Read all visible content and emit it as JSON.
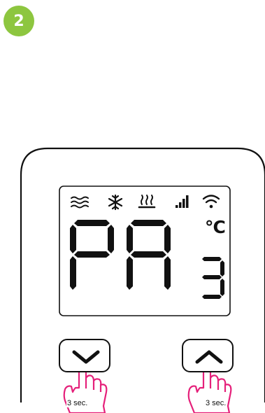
{
  "step": {
    "number": "2"
  },
  "display": {
    "mode_code": "PA",
    "parameter_digit": "3",
    "unit": "°C",
    "icons": [
      "heat-waves-icon",
      "snowflake-icon",
      "floor-heating-icon",
      "signal-bars-icon",
      "wifi-icon"
    ]
  },
  "buttons": {
    "down": {
      "icon": "chevron-down-icon",
      "hold": "3 sec."
    },
    "up": {
      "icon": "chevron-up-icon",
      "hold": "3 sec."
    }
  },
  "colors": {
    "badge": "#8dc63f",
    "hand": "#e5207a",
    "outline": "#111111"
  }
}
